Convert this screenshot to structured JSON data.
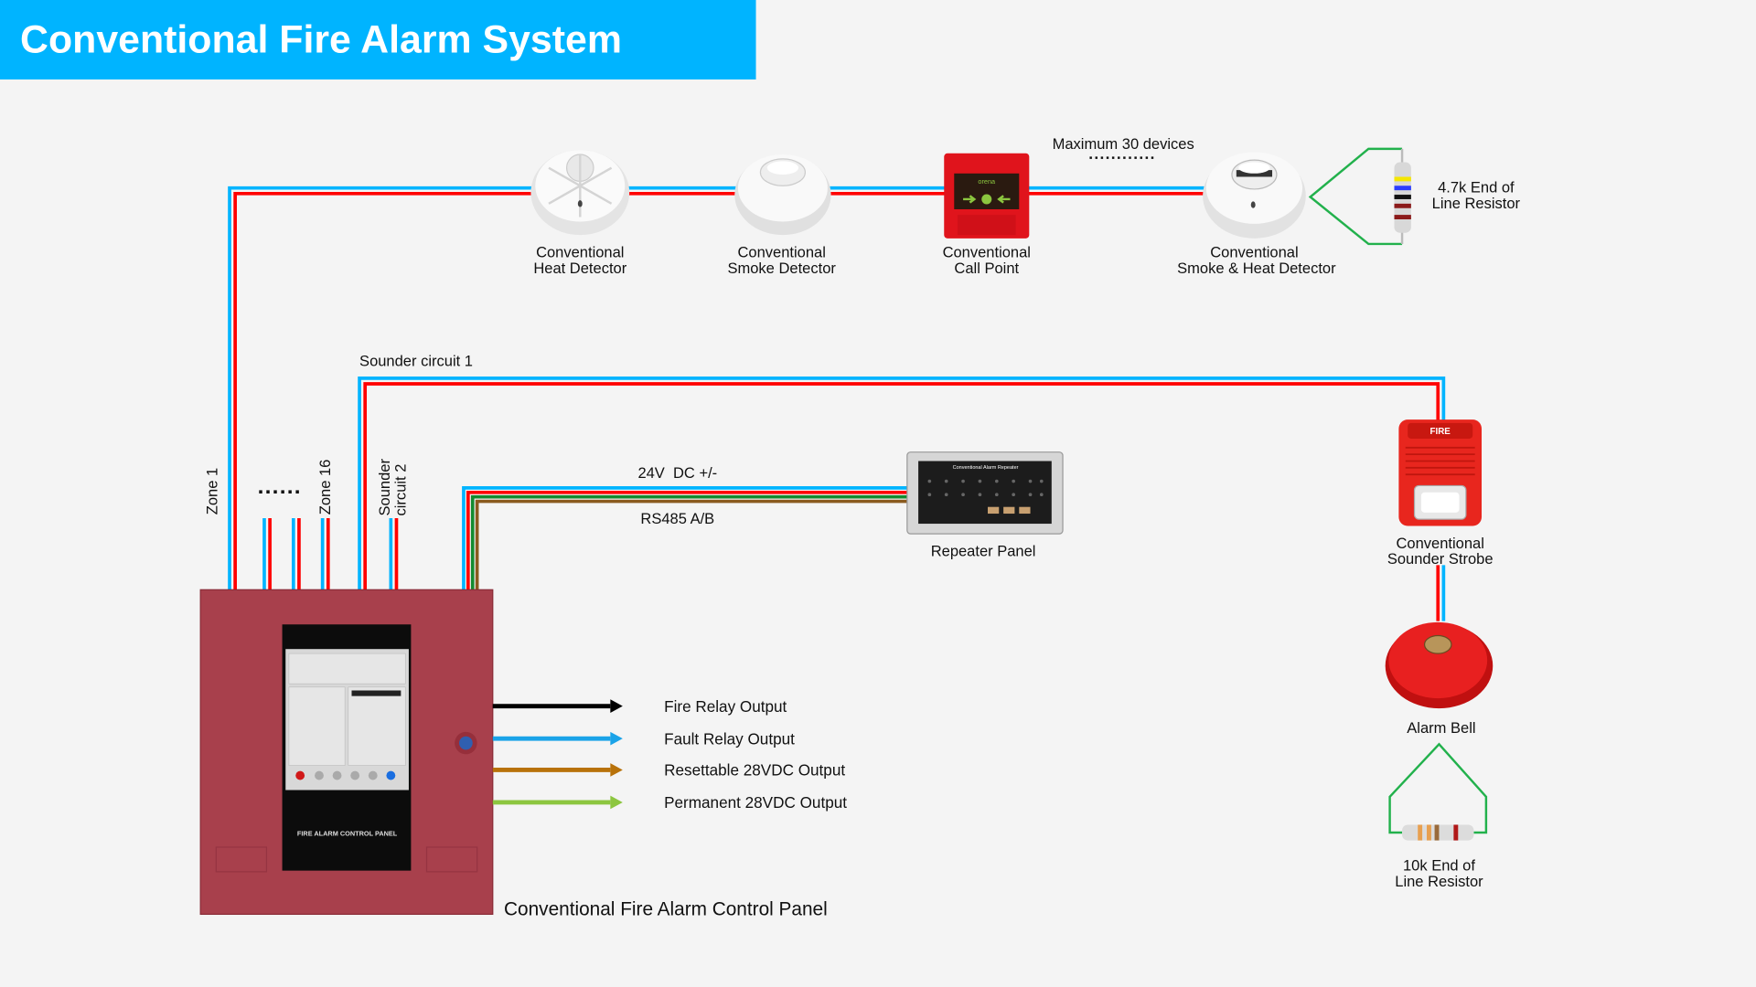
{
  "title": "Conventional Fire Alarm System",
  "colors": {
    "title_bg": "#00b4ff",
    "wire_positive": "#ff0000",
    "wire_negative": "#00b4ff",
    "eol_wire": "#22b14c",
    "panel": "#a8404c"
  },
  "devices": {
    "heat": {
      "l1": "Conventional",
      "l2": "Heat Detector",
      "icon": "heat-detector"
    },
    "smoke": {
      "l1": "Conventional",
      "l2": "Smoke Detector",
      "icon": "smoke-detector"
    },
    "callpoint": {
      "l1": "Conventional",
      "l2": "Call Point",
      "icon": "manual-call-point",
      "brand": "orena"
    },
    "smokeheat": {
      "l1": "Conventional",
      "l2": "Smoke & Heat Detector",
      "icon": "smoke-heat-detector"
    },
    "eol47": {
      "l1": "4.7k End of",
      "l2": "Line Resistor"
    },
    "max": "Maximum 30 devices",
    "repeater": {
      "label": "Repeater Panel",
      "screen_title": "Conventional Alarm Repeater"
    },
    "strobe": {
      "l1": "Conventional",
      "l2": "Sounder Strobe",
      "badge": "FIRE"
    },
    "bell": "Alarm Bell",
    "eol10": {
      "l1": "10k End of",
      "l2": "Line Resistor"
    }
  },
  "circuits": {
    "zone1": "Zone 1",
    "zone16": "Zone 16",
    "dots": "......",
    "sounder1": "Sounder circuit 1",
    "sounder2_l1": "Sounder",
    "sounder2_l2": "circuit 2",
    "dc": "24V  DC +/-",
    "rs485": "RS485 A/B"
  },
  "outputs": [
    {
      "label": "Fire Relay Output",
      "color": "#000000"
    },
    {
      "label": "Fault Relay Output",
      "color": "#1aa3e8"
    },
    {
      "label": "Resettable 28VDC Output",
      "color": "#b8720a"
    },
    {
      "label": "Permanent 28VDC Output",
      "color": "#8cc63f"
    }
  ],
  "panel": {
    "label": "Conventional Fire Alarm Control Panel",
    "face": "FIRE ALARM CONTROL PANEL"
  }
}
